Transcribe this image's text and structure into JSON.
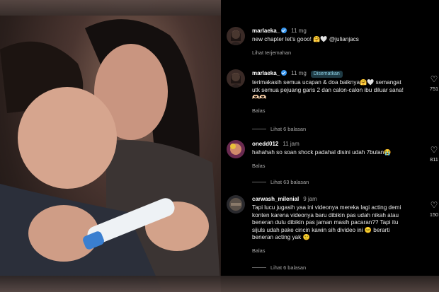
{
  "comments": [
    {
      "username": "marlaeka_",
      "verified": true,
      "time": "11 mg",
      "text": "new chapter let's gooo! 🤗🤍 @julianjacs",
      "action": "Lihat terjemahan"
    },
    {
      "username": "marlaeka_",
      "verified": true,
      "time": "11 mg",
      "badge": "Disematkan",
      "text": "terimakasih semua ucapan & doa baiknya🤗🤍 semangat utk semua pejuang garis 2 dan calon-calon ibu diluar sana! 🫶🏻🫶🏻",
      "action": "Balas",
      "likes": "751",
      "view_replies": "Lihat 6 balasan"
    },
    {
      "username": "onedd012",
      "time": "11 jam",
      "text": "hahahah so soan shock padahal disini udah 7bulan😭",
      "action": "Balas",
      "likes": "811",
      "view_replies": "Lihat 63 balasan"
    },
    {
      "username": "carwash_milenial",
      "time": "9 jam",
      "text": "Tapi lucu jugasih yaa ini videonya mereka lagi acting demi konten karena videonya baru dibikin pas udah nikah atau beneran dulu dibikin pas jaman masih pacaran?? Tapi itu sijuls udah pake cincin kawin sih divideo ini 😑 berarti beneran acting yak 🙂",
      "action": "Balas",
      "likes": "150",
      "view_replies": "Lihat 6 balasan"
    }
  ],
  "colors": {
    "background": "#000000",
    "verified": "#3897f0",
    "muted": "#a8a8a8"
  },
  "icons": {
    "verified": "verified-badge-icon",
    "like": "heart-outline-icon"
  }
}
